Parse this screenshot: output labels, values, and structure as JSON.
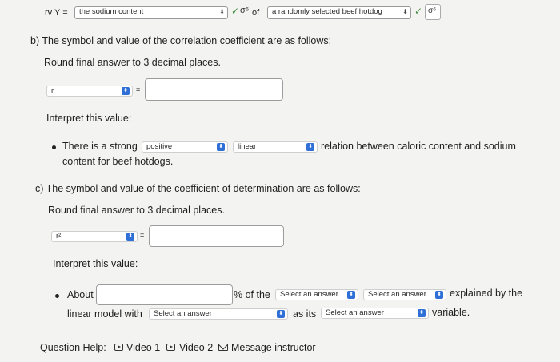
{
  "top_row": {
    "prefix": "rv Y =",
    "variable_select": "the sodium content",
    "of_text": "of",
    "sample_select": "a randomly selected beef hotdog"
  },
  "part_b": {
    "heading": "b) The symbol and value of the correlation coefficient are as follows:",
    "instruction": "Round final answer to 3 decimal places.",
    "symbol_select": "r",
    "equals": "=",
    "value_input": "",
    "interpret_label": "Interpret this value:",
    "sentence_start": "There is a strong",
    "strength_select": "positive",
    "type_select": "linear",
    "sentence_end": "relation between caloric content and sodium",
    "sentence_line2": "content for beef hotdogs."
  },
  "part_c": {
    "heading": "c) The symbol and value of the coefficient of determination are as follows:",
    "instruction": "Round final answer to 3 decimal places.",
    "symbol_select": "r²",
    "equals": "=",
    "value_input": "",
    "interpret_label": "Interpret this value:",
    "about_text": "About",
    "percent_input": "",
    "percent_of_text": "% of the",
    "select1": "Select an answer",
    "select2": "Select an answer",
    "explained_text": "explained by the",
    "line2_start": "linear model with",
    "select3": "Select an answer",
    "as_its_text": "as its",
    "select4": "Select an answer",
    "variable_text": "variable."
  },
  "help": {
    "label": "Question Help:",
    "video1": "Video 1",
    "video2": "Video 2",
    "message": "Message instructor"
  },
  "colors": {
    "accent": "#2f6fd6",
    "check": "#3d8a3d",
    "background": "#f3f3f1"
  }
}
